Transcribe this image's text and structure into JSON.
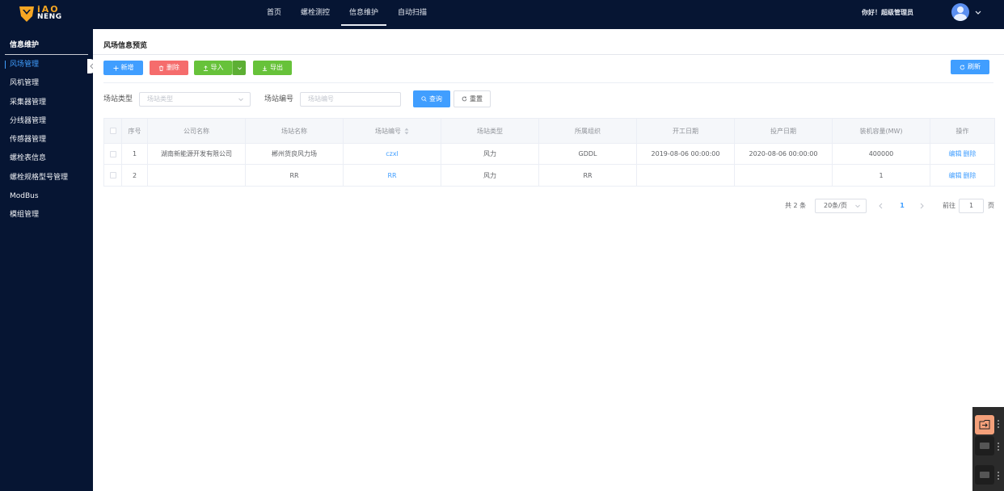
{
  "brand": {
    "line1": "iAO",
    "line2": "NENG",
    "line3": "",
    "accent": "#f6a623"
  },
  "header": {
    "nav": [
      "首页",
      "螺栓测控",
      "信息维护",
      "自动扫描"
    ],
    "active_nav": "信息维护",
    "greeting": "你好！超级管理员",
    "bg": "#061533"
  },
  "sidebar": {
    "title": "信息维护",
    "items": [
      "风场管理",
      "风机管理",
      "采集器管理",
      "分线器管理",
      "传感器管理",
      "螺栓表信息",
      "螺栓规格型号管理",
      "ModBus",
      "模组管理"
    ],
    "active": "风场管理"
  },
  "main": {
    "title": "风场信息预览",
    "toolbar": {
      "add": "新增",
      "delete": "删除",
      "import": "导入",
      "export": "导出",
      "refresh": "刷新"
    },
    "filter": {
      "type_label": "场站类型",
      "type_placeholder": "场站类型",
      "code_label": "场站编号",
      "code_placeholder": "场站编号",
      "query": "查询",
      "reset": "重置"
    },
    "table": {
      "columns": [
        "",
        "序号",
        "公司名称",
        "场站名称",
        "场站编号",
        "场站类型",
        "所属组织",
        "开工日期",
        "投产日期",
        "装机容量(MW)",
        "操作"
      ],
      "rows": [
        [
          "",
          "1",
          "湖南新能源开发有限公司",
          "郴州货良风力场",
          "czxl",
          "风力",
          "GDDL",
          "2019-08-06 00:00:00",
          "2020-08-06 00:00:00",
          "400000",
          ""
        ],
        [
          "",
          "2",
          "",
          "RR",
          "RR",
          "风力",
          "RR",
          "",
          "",
          "1",
          ""
        ]
      ],
      "edit": "编辑",
      "remove": "删除"
    },
    "pagination": {
      "total": "共 2 条",
      "page_size": "20条/页",
      "current": "1",
      "goto_label": "前往",
      "goto_value": "1",
      "page_unit": "页"
    }
  },
  "colors": {
    "primary": "#409eff",
    "danger": "#f56c6c",
    "success": "#67c23a"
  }
}
